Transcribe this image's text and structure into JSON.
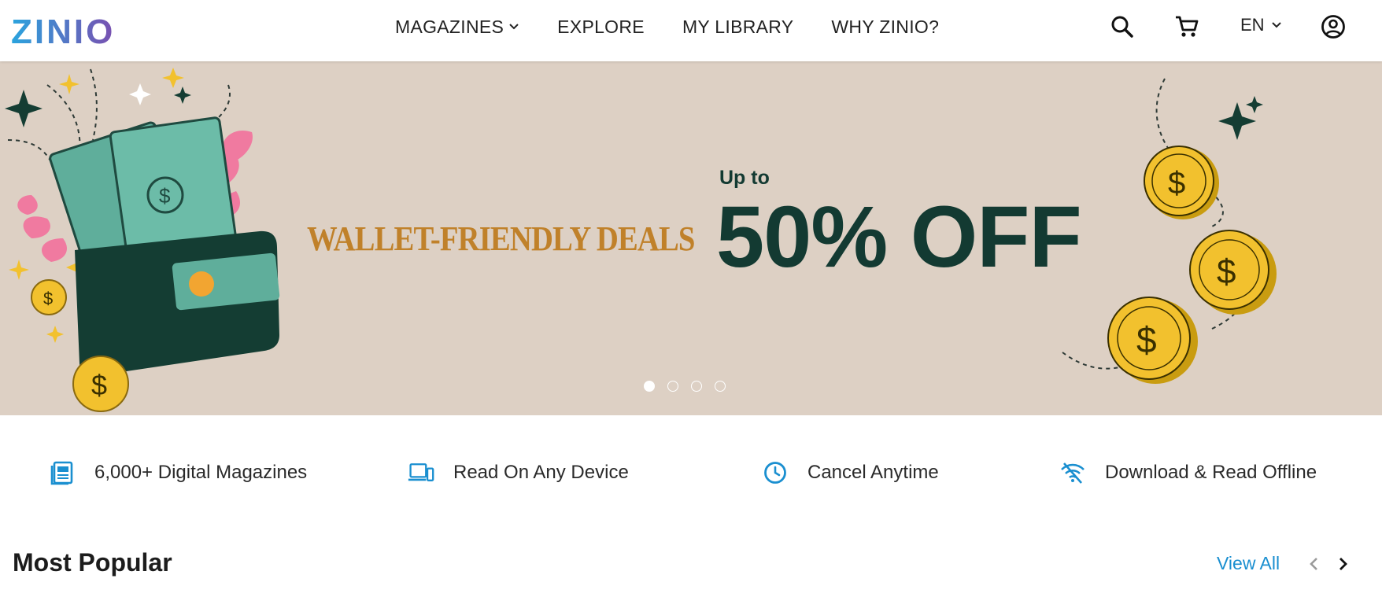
{
  "header": {
    "logo_text": "ZINIO",
    "nav": [
      {
        "label": "MAGAZINES",
        "has_dropdown": true
      },
      {
        "label": "EXPLORE"
      },
      {
        "label": "MY LIBRARY"
      },
      {
        "label": "WHY ZINIO?"
      }
    ],
    "icons": [
      "search-icon",
      "cart-icon",
      "account-icon"
    ],
    "language": "EN"
  },
  "banner": {
    "tagline": "WALLET-FRIENDLY DEALS",
    "pre_headline": "Up to",
    "headline": "50% OFF",
    "slide_count": 4,
    "active_slide": 1
  },
  "features": [
    {
      "icon": "magazines-icon",
      "label": "6,000+ Digital Magazines"
    },
    {
      "icon": "devices-icon",
      "label": "Read On Any Device"
    },
    {
      "icon": "clock-icon",
      "label": "Cancel Anytime"
    },
    {
      "icon": "offline-icon",
      "label": "Download & Read Offline"
    }
  ],
  "popular": {
    "title": "Most Popular",
    "view_all": "View All"
  },
  "colors": {
    "brand_gradient_start": "#2aa4de",
    "brand_gradient_end": "#7a4fb0",
    "accent": "#1a8fd0",
    "banner_bg": "#ddd0c4",
    "headline": "#133a32",
    "tagline": "#c0812a"
  }
}
